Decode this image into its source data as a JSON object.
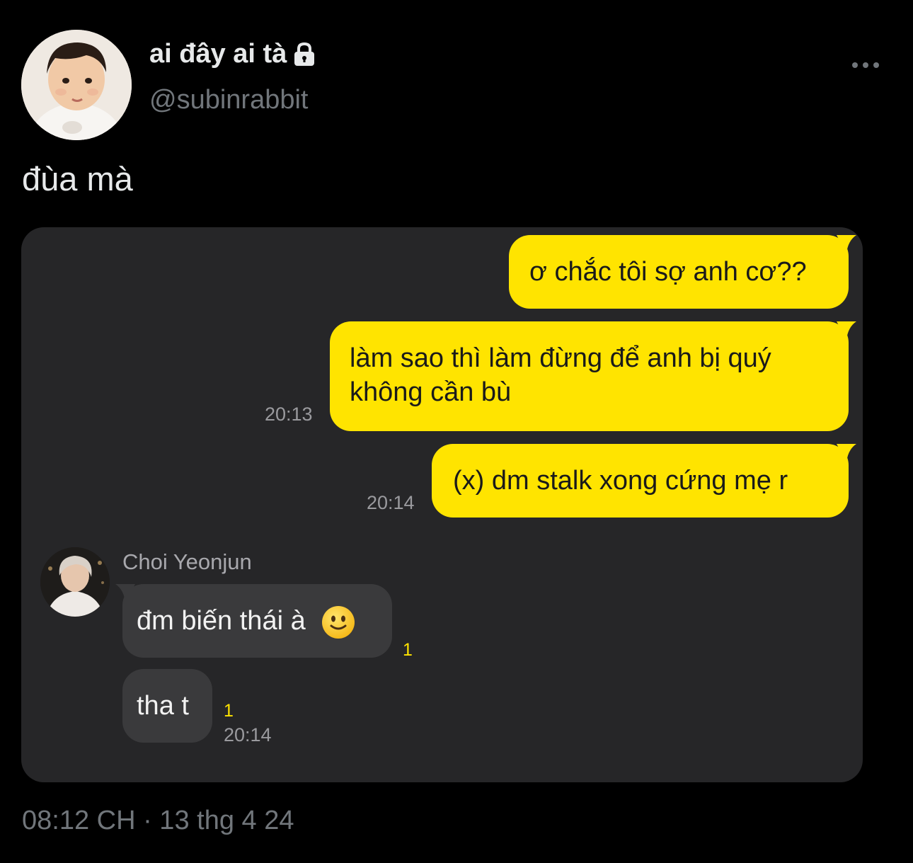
{
  "author": {
    "display_name": "ai đây ai tà",
    "handle": "@subinrabbit",
    "protected_icon": "lock-icon",
    "avatar_icon": "profile-photo-child"
  },
  "header": {
    "more_icon": "more-horizontal-icon"
  },
  "tweet": {
    "text": "đùa mà"
  },
  "chat": {
    "messages_out": [
      {
        "text": "ơ chắc tôi sợ anh cơ??"
      },
      {
        "line1": "làm sao thì làm đừng để anh bị quý",
        "line2": "không cần bù",
        "time": "20:13"
      },
      {
        "text": "(x) dm stalk xong cứng mẹ r",
        "time": "20:14"
      }
    ],
    "contact": {
      "name": "Choi Yeonjun",
      "avatar_icon": "contact-photo"
    },
    "messages_in": [
      {
        "text": "đm biến thái à",
        "emoji": "slightly-smiling-face-emoji",
        "unread": "1"
      },
      {
        "text": "tha t",
        "unread": "1",
        "time": "20:14"
      }
    ],
    "colors": {
      "outgoing_bubble": "#ffe400",
      "incoming_bubble": "#3a3a3c",
      "background": "#262628"
    }
  },
  "footer": {
    "meta": "08:12 CH · 13 thg 4 24"
  },
  "colors": {
    "page_background": "#000000",
    "primary_text": "#e7e9ea",
    "secondary_text": "#71767b"
  }
}
